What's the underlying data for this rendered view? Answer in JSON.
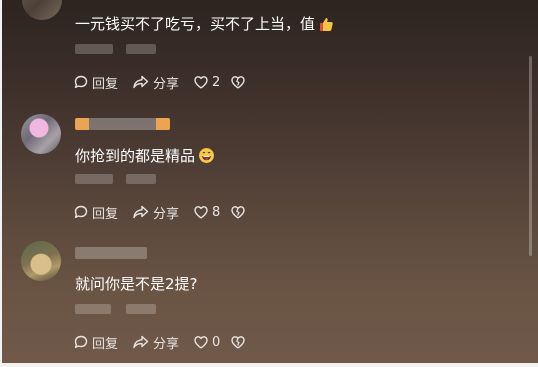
{
  "comments": [
    {
      "text": "一元钱买不了吃亏，买不了上当，值",
      "emoji_icon": "thumbs-up-emoji-icon",
      "actions": {
        "reply_label": "回复",
        "share_label": "分享",
        "like_count": "2"
      }
    },
    {
      "text": "你抢到的都是精品",
      "emoji_icon": "grinning-face-emoji-icon",
      "actions": {
        "reply_label": "回复",
        "share_label": "分享",
        "like_count": "8"
      }
    },
    {
      "text": "就问你是不是2提?",
      "actions": {
        "reply_label": "回复",
        "share_label": "分享",
        "like_count": "0"
      }
    }
  ],
  "colors": {
    "background_top": "#2d2420",
    "background_bottom": "#70594a",
    "text": "#ffffff",
    "action_text": "#e8e4e2",
    "name_accent": "#e9a552"
  }
}
